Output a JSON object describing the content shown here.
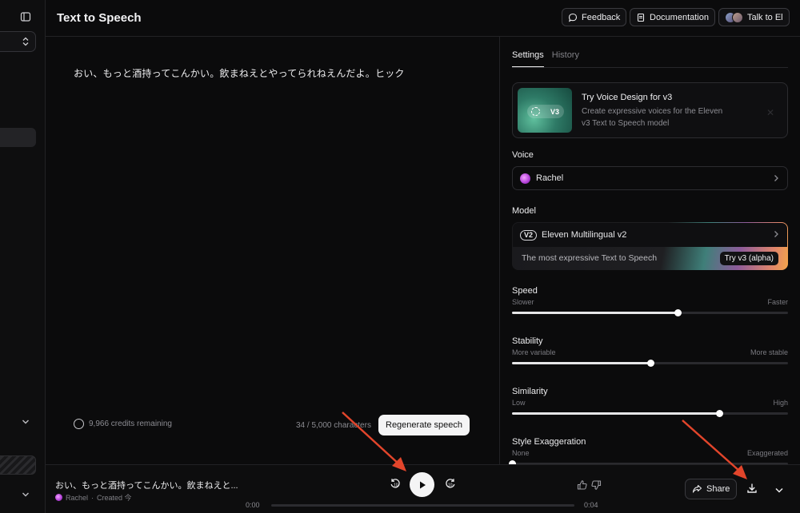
{
  "header": {
    "title": "Text to Speech",
    "feedback_label": "Feedback",
    "documentation_label": "Documentation",
    "talk_label": "Talk to El"
  },
  "editor": {
    "text": "おい、もっと酒持ってこんかい。飲まねえとやってられねえんだよ。ヒック",
    "credits": "9,966 credits remaining",
    "char_count": "34 / 5,000 characters",
    "regenerate_label": "Regenerate speech"
  },
  "panel": {
    "tabs": [
      {
        "label": "Settings",
        "active": true
      },
      {
        "label": "History",
        "active": false
      }
    ],
    "promo": {
      "badge": "V3",
      "title": "Try Voice Design for v3",
      "description": "Create expressive voices for the Eleven v3 Text to Speech model",
      "close_icon": "close-icon"
    },
    "voice": {
      "label": "Voice",
      "value": "Rachel"
    },
    "model": {
      "label": "Model",
      "badge": "V2",
      "value": "Eleven Multilingual v2",
      "subtitle": "The most expressive Text to Speech",
      "try_label": "Try v3 (alpha)"
    },
    "sliders": [
      {
        "title": "Speed",
        "min_label": "Slower",
        "max_label": "Faster",
        "value": 0.6
      },
      {
        "title": "Stability",
        "min_label": "More variable",
        "max_label": "More stable",
        "value": 0.5
      },
      {
        "title": "Similarity",
        "min_label": "Low",
        "max_label": "High",
        "value": 0.75
      },
      {
        "title": "Style Exaggeration",
        "min_label": "None",
        "max_label": "Exaggerated",
        "value": 0.0
      }
    ]
  },
  "player": {
    "title": "おい、もっと酒持ってこんかい。飲まねえと...",
    "voice": "Rachel",
    "created": "Created 今",
    "time_current": "0:00",
    "time_total": "0:04",
    "share_label": "Share"
  },
  "colors": {
    "background": "#0b0b0c",
    "annotation_arrow": "#e2452b",
    "accent_purple": "#b13fd6"
  }
}
